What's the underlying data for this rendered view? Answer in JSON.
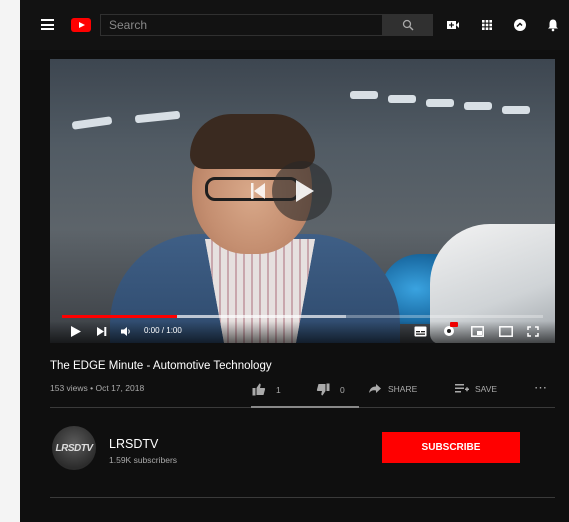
{
  "search": {
    "placeholder": "Search"
  },
  "player": {
    "time": "0:00 / 1:00",
    "progress_played_fraction": 0.24,
    "progress_loaded_fraction": 0.59
  },
  "video": {
    "title": "The EDGE Minute - Automotive Technology",
    "meta": "153 views • Oct 17, 2018",
    "likes": "1",
    "dislikes": "0",
    "share_label": "SHARE",
    "save_label": "SAVE",
    "more_label": "⋯"
  },
  "channel": {
    "avatar_text": "LRSDTV",
    "name": "LRSDTV",
    "subscribers": "1.59K subscribers",
    "subscribe_label": "SUBSCRIBE"
  },
  "colors": {
    "accent": "#ff0000",
    "background": "#0f0f0f"
  },
  "icons": [
    "menu-icon",
    "youtube-logo-icon",
    "search-icon",
    "video-camera-icon",
    "apps-icon",
    "messages-icon",
    "bell-icon",
    "play-icon",
    "next-icon",
    "volume-icon",
    "subtitles-icon",
    "settings-icon",
    "miniplayer-icon",
    "theater-icon",
    "fullscreen-icon",
    "thumbs-up-icon",
    "thumbs-down-icon",
    "share-icon",
    "save-icon",
    "more-icon"
  ]
}
